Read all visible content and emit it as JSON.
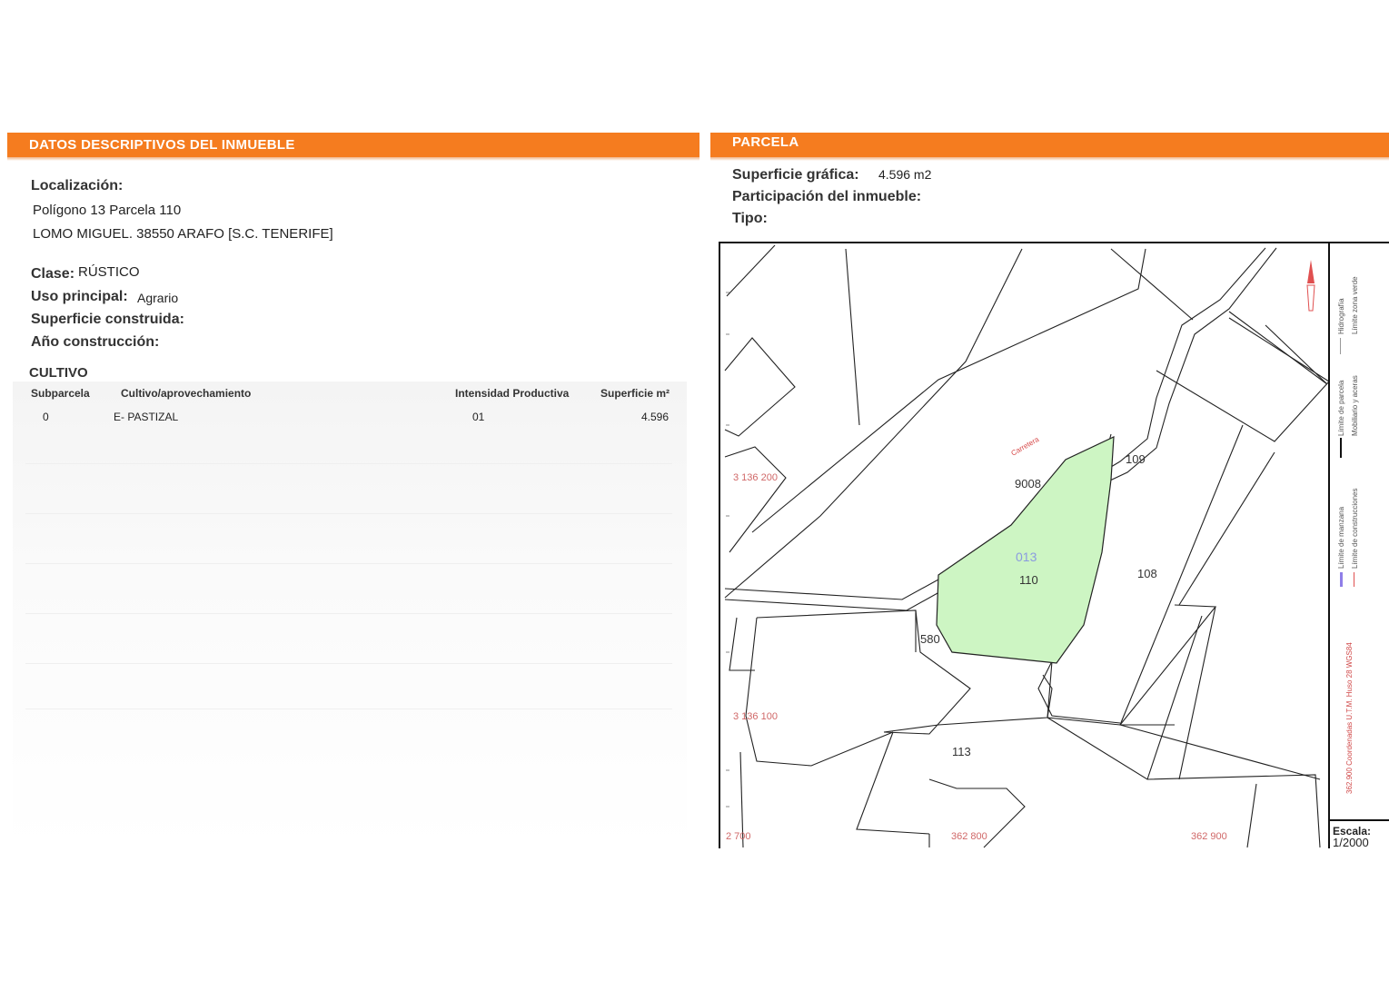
{
  "left": {
    "section_title": "DATOS DESCRIPTIVOS DEL INMUEBLE",
    "localizacion_label": "Localización:",
    "address_line1": "Polígono 13 Parcela 110",
    "address_line2": "LOMO MIGUEL. 38550 ARAFO [S.C. TENERIFE]",
    "clase_label": "Clase:",
    "clase_value": "RÚSTICO",
    "uso_label": "Uso principal:",
    "uso_value": "Agrario",
    "superficie_construida_label": "Superficie construida:",
    "anio_label": "Año construcción:",
    "cultivo": {
      "title": "CULTIVO",
      "headers": [
        "Subparcela",
        "Cultivo/aprovechamiento",
        "Intensidad Productiva",
        "Superficie m²"
      ],
      "rows": [
        {
          "subparcela": "0",
          "cultivo": "E- PASTIZAL",
          "intensidad": "01",
          "superficie": "4.596"
        }
      ]
    }
  },
  "right": {
    "section_title": "PARCELA",
    "superficie_grafica_label": "Superficie gráfica:",
    "superficie_grafica_value": "4.596 m2",
    "participacion_label": "Participación del inmueble:",
    "tipo_label": "Tipo:",
    "map": {
      "highlight_color": "#cdf5c3",
      "polygon_labels": {
        "poligono": "013",
        "parcela_main": "110",
        "p109": "109",
        "p108": "108",
        "p580": "580",
        "p113": "113",
        "p9008": "9008"
      },
      "road_label": "Carretera",
      "coords": {
        "y1": "3 136 200",
        "y2": "3 136 100",
        "x0": "2 700",
        "x1": "362 800",
        "x2": "362 900"
      },
      "legend": {
        "item1": "Límite de parcela",
        "item2": "Hidrografía",
        "item3": "Mobiliario y aceras",
        "item4": "Límite zona verde",
        "item5": "Límite de manzana",
        "item6": "Límite de construcciones",
        "crs": "362.900 Coordenadas U.T.M. Huso 28 WGS84"
      },
      "escala_label": "Escala:",
      "escala_value": "1/2000"
    }
  }
}
